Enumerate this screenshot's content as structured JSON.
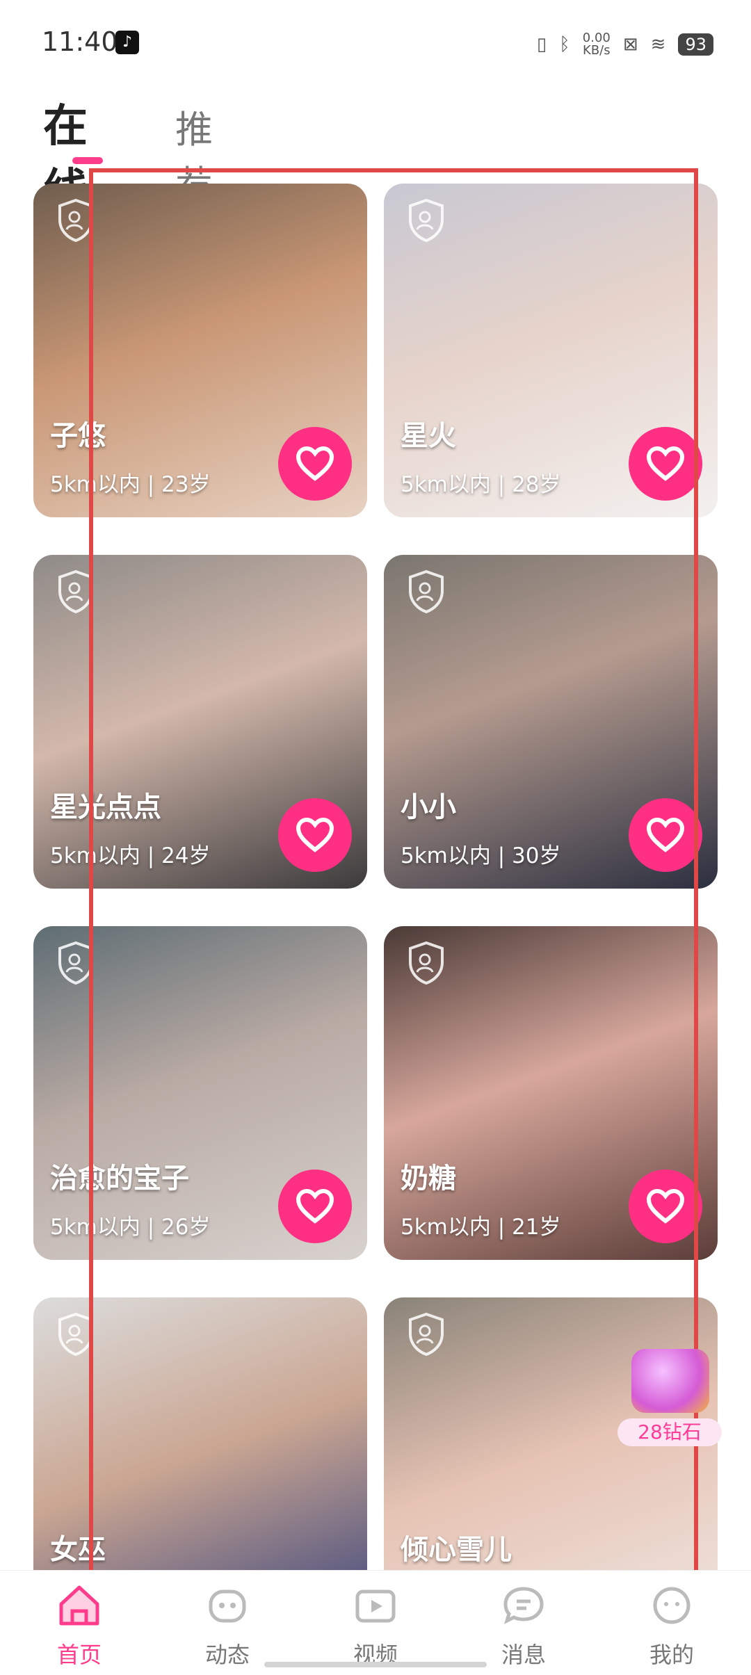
{
  "status_bar": {
    "time": "11:40",
    "net_speed_value": "0.00",
    "net_speed_unit": "KB/s",
    "battery": "93"
  },
  "tabs": [
    {
      "label": "在线",
      "active": true
    },
    {
      "label": "推荐",
      "active": false
    }
  ],
  "profiles": [
    {
      "name": "子悠",
      "distance": "5km以内",
      "age": "23岁",
      "sep": "|"
    },
    {
      "name": "星火",
      "distance": "5km以内",
      "age": "28岁",
      "sep": "|"
    },
    {
      "name": "星光点点",
      "distance": "5km以内",
      "age": "24岁",
      "sep": "|"
    },
    {
      "name": "小小",
      "distance": "5km以内",
      "age": "30岁",
      "sep": "|"
    },
    {
      "name": "治愈的宝子",
      "distance": "5km以内",
      "age": "26岁",
      "sep": "|"
    },
    {
      "name": "奶糖",
      "distance": "5km以内",
      "age": "21岁",
      "sep": "|"
    },
    {
      "name": "女巫",
      "distance": "",
      "age": "",
      "sep": ""
    },
    {
      "name": "倾心雪儿",
      "distance": "",
      "age": "",
      "sep": ""
    }
  ],
  "gift_float": {
    "label": "28钻石"
  },
  "bottom_nav": [
    {
      "label": "首页",
      "icon": "home-icon",
      "active": true
    },
    {
      "label": "动态",
      "icon": "moments-icon",
      "active": false
    },
    {
      "label": "视频",
      "icon": "video-icon",
      "active": false
    },
    {
      "label": "消息",
      "icon": "message-icon",
      "active": false
    },
    {
      "label": "我的",
      "icon": "profile-icon",
      "active": false
    }
  ],
  "colors": {
    "accent": "#ff3c8c",
    "like_button": "#ff2f83",
    "highlight_box": "#e04848"
  }
}
